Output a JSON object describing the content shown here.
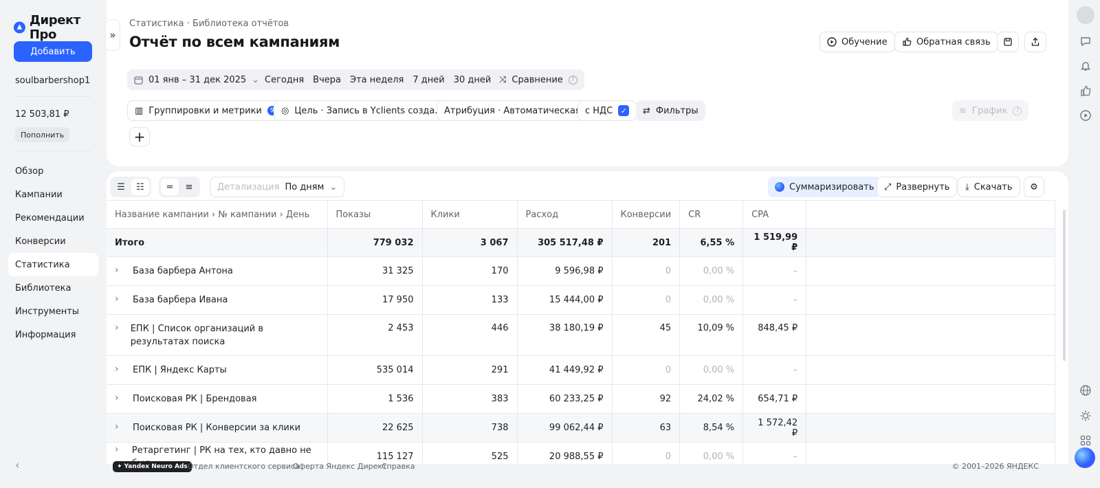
{
  "brand": {
    "name": "Директ Про",
    "accent": "#2b63ff"
  },
  "sidebar": {
    "add_label": "Добавить",
    "account": "soulbarbershop1",
    "balance": "12 503,81 ₽",
    "topup_label": "Пополнить",
    "items": [
      {
        "label": "Обзор"
      },
      {
        "label": "Кампании"
      },
      {
        "label": "Рекомендации"
      },
      {
        "label": "Конверсии"
      },
      {
        "label": "Статистика",
        "active": true
      },
      {
        "label": "Библиотека"
      },
      {
        "label": "Инструменты"
      },
      {
        "label": "Информация"
      }
    ]
  },
  "header": {
    "breadcrumb": "Статистика · Библиотека отчётов",
    "title": "Отчёт по всем кампаниям",
    "learn_label": "Обучение",
    "feedback_label": "Обратная связь"
  },
  "period": {
    "range": "01 янв – 31 дек 2025",
    "presets": [
      "Сегодня",
      "Вчера",
      "Эта неделя",
      "7 дней",
      "30 дней"
    ],
    "compare_label": "Сравнение"
  },
  "filters": {
    "groupings_label": "Группировки и метрики",
    "groupings_count": "9",
    "goal_label": "Цель · Запись в Yclients созда...",
    "attribution_label": "Атрибуция · Автоматическая",
    "vat_label": "с НДС",
    "vat_checked": true,
    "filters_label": "Фильтры",
    "chart_label": "График"
  },
  "table_toolbar": {
    "detail_label": "Детализация",
    "detail_value": "По дням",
    "summarize_label": "Суммаризировать",
    "expand_label": "Развернуть",
    "download_label": "Скачать"
  },
  "table": {
    "columns": [
      "Название кампании › № кампании › День",
      "Показы",
      "Клики",
      "Расход",
      "Конверсии",
      "CR",
      "CPA"
    ],
    "total": {
      "name": "Итого",
      "impressions": "779 032",
      "clicks": "3 067",
      "cost": "305 517,48 ₽",
      "conversions": "201",
      "cr": "6,55 %",
      "cpa": "1 519,99 ₽"
    },
    "rows": [
      {
        "name": "База барбера Антона",
        "impressions": "31 325",
        "clicks": "170",
        "cost": "9 596,98 ₽",
        "conversions": "0",
        "cr": "0,00 %",
        "cpa": "–"
      },
      {
        "name": "База барбера Ивана",
        "impressions": "17 950",
        "clicks": "133",
        "cost": "15 444,00 ₽",
        "conversions": "0",
        "cr": "0,00 %",
        "cpa": "–"
      },
      {
        "name": "ЕПК | Список организаций в результатах поиска",
        "impressions": "2 453",
        "clicks": "446",
        "cost": "38 180,19 ₽",
        "conversions": "45",
        "cr": "10,09 %",
        "cpa": "848,45 ₽"
      },
      {
        "name": "ЕПК | Яндекс Карты",
        "impressions": "535 014",
        "clicks": "291",
        "cost": "41 449,92 ₽",
        "conversions": "0",
        "cr": "0,00 %",
        "cpa": "–"
      },
      {
        "name": "Поисковая РК | Брендовая",
        "impressions": "1 536",
        "clicks": "383",
        "cost": "60 233,25 ₽",
        "conversions": "92",
        "cr": "24,02 %",
        "cpa": "654,71 ₽"
      },
      {
        "name": "Поисковая РК | Конверсии за клики",
        "impressions": "22 625",
        "clicks": "738",
        "cost": "99 062,44 ₽",
        "conversions": "63",
        "cr": "8,54 %",
        "cpa": "1 572,42 ₽"
      },
      {
        "name": "Ретаргетинг | РК на тех, кто давно не был",
        "impressions": "115 127",
        "clicks": "525",
        "cost": "20 988,55 ₽",
        "conversions": "0",
        "cr": "0,00 %",
        "cpa": "–"
      }
    ]
  },
  "footer": {
    "badge": "Yandex Neuro Ads",
    "links": [
      "Отдел клиентского сервиса",
      "Оферта Яндекс Директ",
      "Справка"
    ],
    "copyright": "© 2001–2026 ЯНДЕКС"
  }
}
